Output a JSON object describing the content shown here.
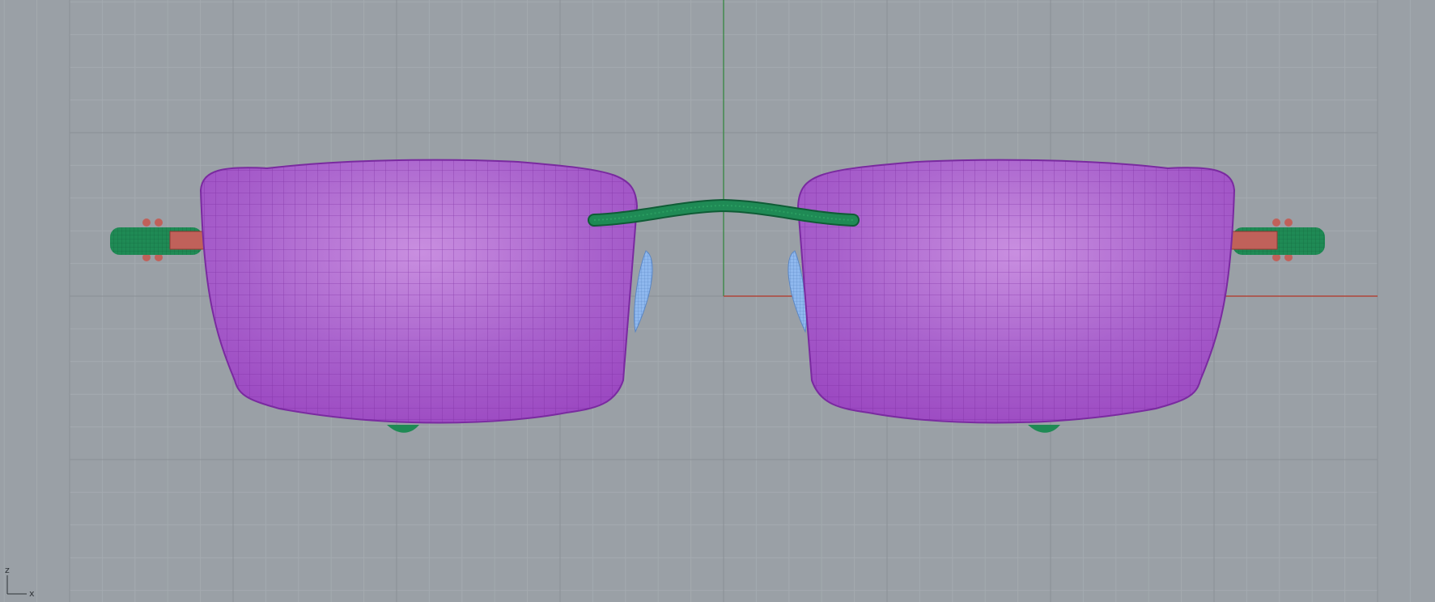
{
  "viewport": {
    "background": "#9aa0a6",
    "grid_minor_color": "#a4aab0",
    "grid_major_color": "#8b9096",
    "axis_x_color": "#b0463a",
    "axis_z_color": "#3d8a48"
  },
  "axis_indicator": {
    "z_label": "z",
    "x_label": "x",
    "color": "#2f3338"
  },
  "model": {
    "lens_color": "#9a45c0",
    "lens_highlight": "#c98fe0",
    "lens_wire_color": "#7a2aa0",
    "frame_color": "#1f8a55",
    "hinge_color": "#c0615a",
    "nosepad_color": "#8fb8ee"
  }
}
